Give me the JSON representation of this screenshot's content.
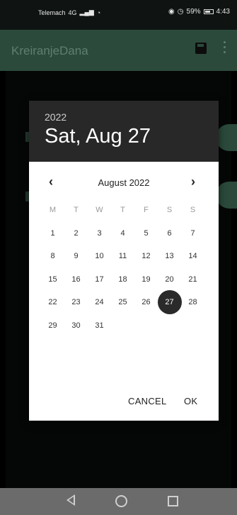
{
  "status_bar": {
    "carrier": "Telemach",
    "network": "4G",
    "battery": "59%",
    "time": "4:43"
  },
  "app_bar": {
    "title": "KreiranjeDana"
  },
  "date_picker": {
    "year": "2022",
    "selected_date": "Sat, Aug 27",
    "month_label": "August 2022",
    "prev_icon": "chevron-left-icon",
    "next_icon": "chevron-right-icon",
    "weekdays": [
      "M",
      "T",
      "W",
      "T",
      "F",
      "S",
      "S"
    ],
    "weeks": [
      [
        "1",
        "2",
        "3",
        "4",
        "5",
        "6",
        "7"
      ],
      [
        "8",
        "9",
        "10",
        "11",
        "12",
        "13",
        "14"
      ],
      [
        "15",
        "16",
        "17",
        "18",
        "19",
        "20",
        "21"
      ],
      [
        "22",
        "23",
        "24",
        "25",
        "26",
        "27",
        "28"
      ],
      [
        "29",
        "30",
        "31",
        "",
        "",
        "",
        ""
      ]
    ],
    "selected_day": "27",
    "cancel_label": "CANCEL",
    "ok_label": "OK"
  },
  "nav_bar": {
    "back_icon": "back-triangle-icon",
    "home_icon": "home-circle-icon",
    "recents_icon": "recents-square-icon"
  }
}
